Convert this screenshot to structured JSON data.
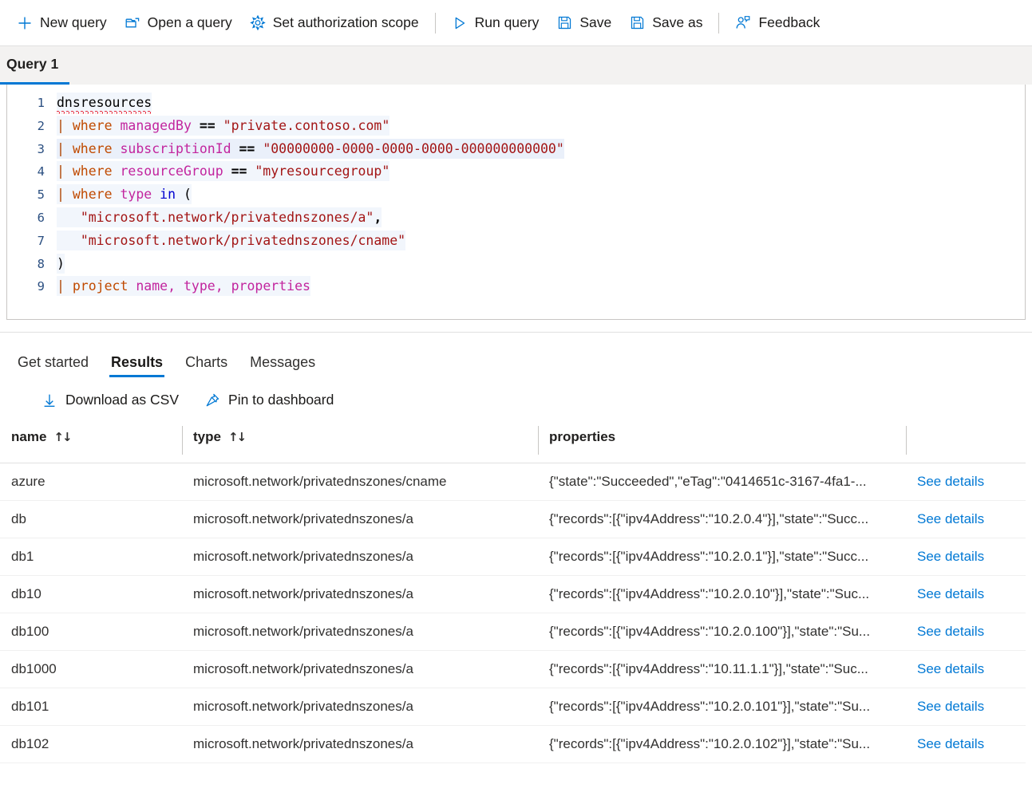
{
  "toolbar": {
    "buttons": [
      {
        "label": "New query",
        "icon": "plus-icon"
      },
      {
        "label": "Open a query",
        "icon": "folder-open-icon"
      },
      {
        "label": "Set authorization scope",
        "icon": "gear-icon"
      },
      {
        "label": "Run query",
        "icon": "play-icon"
      },
      {
        "label": "Save",
        "icon": "save-icon"
      },
      {
        "label": "Save as",
        "icon": "save-as-icon"
      },
      {
        "label": "Feedback",
        "icon": "feedback-person-icon"
      }
    ]
  },
  "query_tab": {
    "label": "Query 1"
  },
  "editor": {
    "lines": [
      {
        "number": "1"
      },
      {
        "number": "2"
      },
      {
        "number": "3"
      },
      {
        "number": "4"
      },
      {
        "number": "5"
      },
      {
        "number": "6"
      },
      {
        "number": "7"
      },
      {
        "number": "8"
      },
      {
        "number": "9"
      }
    ],
    "tokens": {
      "table": "dnsresources",
      "pipe": "|",
      "kw_where": "where",
      "kw_project": "project",
      "kw_in": "in",
      "op_eq": "==",
      "col_managedBy": "managedBy",
      "col_subscriptionId": "subscriptionId",
      "col_resourceGroup": "resourceGroup",
      "col_type": "type",
      "col_name": "name",
      "col_properties": "properties",
      "str_managedBy": "\"private.contoso.com\"",
      "str_subscriptionId": "\"00000000-0000-0000-0000-000000000000\"",
      "str_resourceGroup": "\"myresourcegroup\"",
      "str_type_a": "\"microsoft.network/privatednszones/a\"",
      "str_type_cname": "\"microsoft.network/privatednszones/cname\"",
      "paren_open": "(",
      "paren_close": ")",
      "comma": ",",
      "comma_name": ",",
      "comma_type": ","
    },
    "full_text": "dnsresources\n| where managedBy == \"private.contoso.com\"\n| where subscriptionId == \"00000000-0000-0000-0000-000000000000\"\n| where resourceGroup == \"myresourcegroup\"\n| where type in (\n   \"microsoft.network/privatednszones/a\",\n   \"microsoft.network/privatednszones/cname\"\n)\n| project name, type, properties"
  },
  "result_tabs": [
    {
      "label": "Get started",
      "active": false
    },
    {
      "label": "Results",
      "active": true
    },
    {
      "label": "Charts",
      "active": false
    },
    {
      "label": "Messages",
      "active": false
    }
  ],
  "result_actions": [
    {
      "label": "Download as CSV",
      "icon": "download-arrow-icon"
    },
    {
      "label": "Pin to dashboard",
      "icon": "pin-icon"
    }
  ],
  "table": {
    "columns": [
      {
        "key": "name",
        "label": "name",
        "sortable": true,
        "sort_icon": "↑↓"
      },
      {
        "key": "type",
        "label": "type",
        "sortable": true,
        "sort_icon": "↑↓"
      },
      {
        "key": "properties",
        "label": "properties",
        "sortable": false
      },
      {
        "key": "actions",
        "label": "",
        "sortable": false
      }
    ],
    "link_label": "See details",
    "rows": [
      {
        "name": "azure",
        "type": "microsoft.network/privatednszones/cname",
        "properties": "{\"state\":\"Succeeded\",\"eTag\":\"0414651c-3167-4fa1-...",
        "link": "See details"
      },
      {
        "name": "db",
        "type": "microsoft.network/privatednszones/a",
        "properties": "{\"records\":[{\"ipv4Address\":\"10.2.0.4\"}],\"state\":\"Succ...",
        "link": "See details"
      },
      {
        "name": "db1",
        "type": "microsoft.network/privatednszones/a",
        "properties": "{\"records\":[{\"ipv4Address\":\"10.2.0.1\"}],\"state\":\"Succ...",
        "link": "See details"
      },
      {
        "name": "db10",
        "type": "microsoft.network/privatednszones/a",
        "properties": "{\"records\":[{\"ipv4Address\":\"10.2.0.10\"}],\"state\":\"Suc...",
        "link": "See details"
      },
      {
        "name": "db100",
        "type": "microsoft.network/privatednszones/a",
        "properties": "{\"records\":[{\"ipv4Address\":\"10.2.0.100\"}],\"state\":\"Su...",
        "link": "See details"
      },
      {
        "name": "db1000",
        "type": "microsoft.network/privatednszones/a",
        "properties": "{\"records\":[{\"ipv4Address\":\"10.11.1.1\"}],\"state\":\"Suc...",
        "link": "See details"
      },
      {
        "name": "db101",
        "type": "microsoft.network/privatednszones/a",
        "properties": "{\"records\":[{\"ipv4Address\":\"10.2.0.101\"}],\"state\":\"Su...",
        "link": "See details"
      },
      {
        "name": "db102",
        "type": "microsoft.network/privatednszones/a",
        "properties": "{\"records\":[{\"ipv4Address\":\"10.2.0.102\"}],\"state\":\"Su...",
        "link": "See details"
      }
    ]
  },
  "colors": {
    "accent": "#0078d4",
    "link": "#0078d4",
    "tab_underline": "#0078d4",
    "keyword": "#c04a00",
    "column_token": "#c2259e",
    "string_token": "#a31515",
    "operator_in": "#0000d0",
    "error_squiggle": "#e81123",
    "tabstrip_bg": "#f3f2f1"
  }
}
